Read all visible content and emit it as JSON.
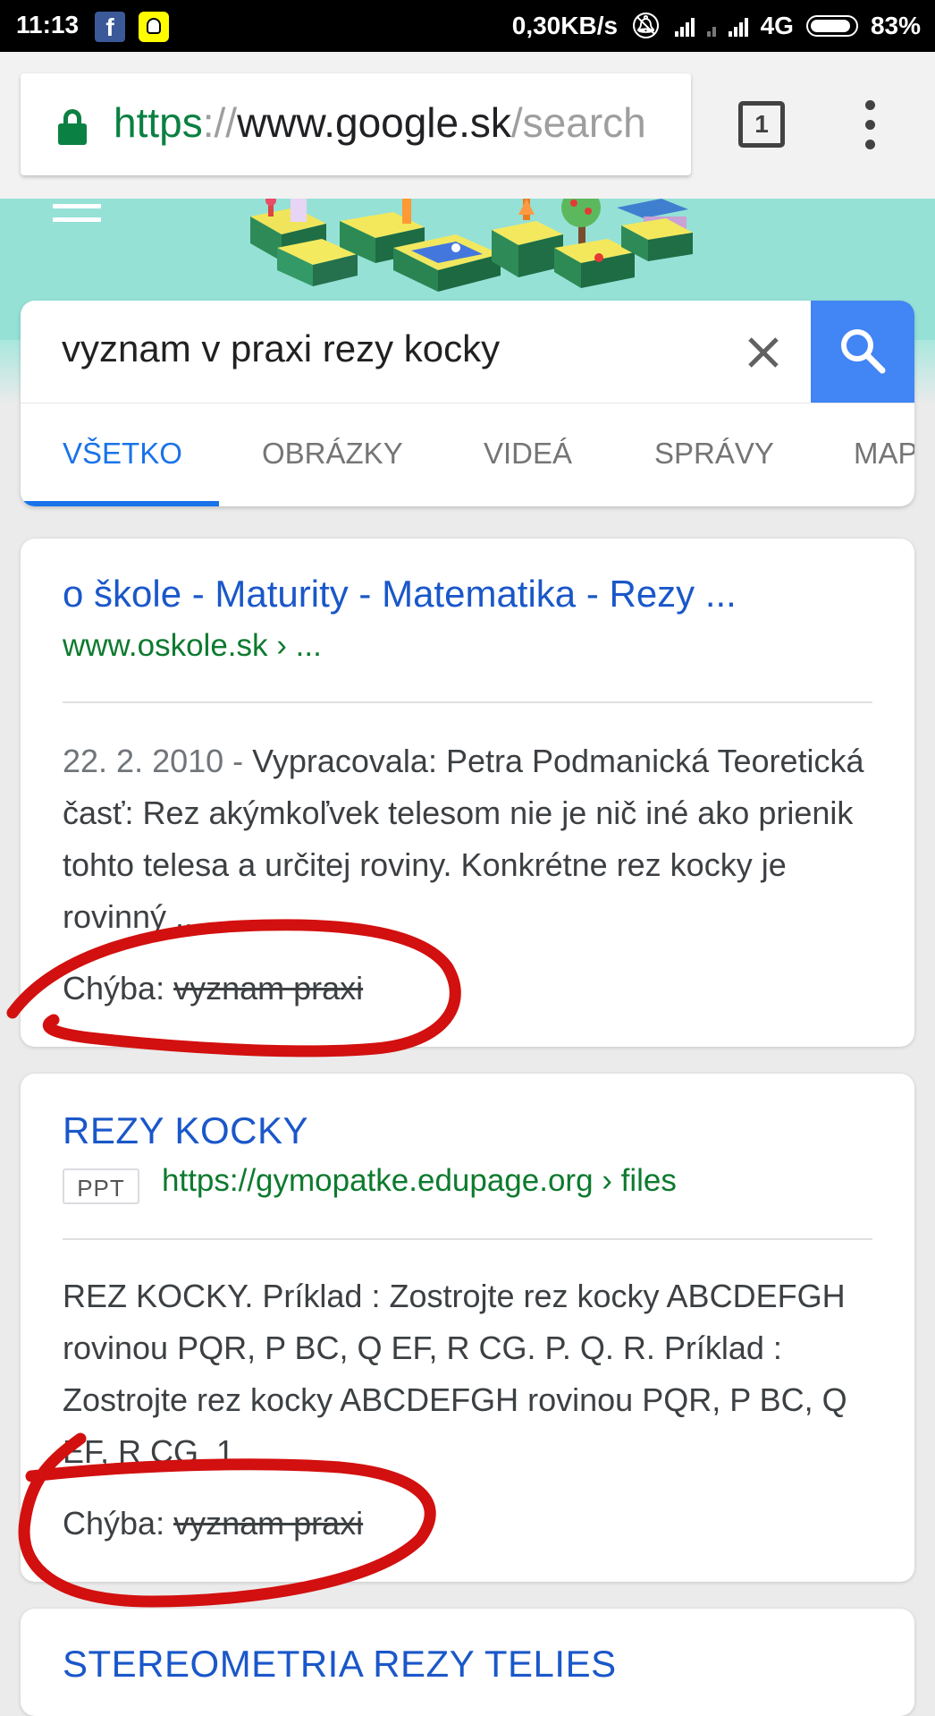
{
  "status_bar": {
    "time": "11:13",
    "speed": "0,30KB/s",
    "network": "4G",
    "battery": "83%",
    "icons": [
      "facebook-icon",
      "snapchat-icon",
      "mute-icon",
      "signal-icon",
      "data-arrows-icon",
      "battery-icon"
    ]
  },
  "browser": {
    "url_scheme": "https",
    "url_separator": "://",
    "url_host": "www.google.sk",
    "url_path": "/search",
    "tab_count": "1"
  },
  "search": {
    "query": "vyznam v praxi rezy kocky",
    "tabs": [
      "VŠETKO",
      "OBRÁZKY",
      "VIDEÁ",
      "SPRÁVY",
      "MAP"
    ],
    "active_tab": "VŠETKO"
  },
  "results": [
    {
      "title": "o škole - Maturity - Matematika - Rezy ...",
      "url": "www.oskole.sk › ...",
      "date": "22. 2. 2010",
      "date_separator": " - ",
      "snippet": "Vypracovala: Petra Podmanická Teoretická časť: Rez akýmkoľvek telesom nie je nič iné ako prienik tohto telesa a určitej roviny. Konkrétne rez kocky je rovinný ...",
      "missing_label": "Chýba:",
      "missing_terms": "vyznam praxi"
    },
    {
      "title": "REZY KOCKY",
      "badge": "PPT",
      "url": "https://gymopatke.edupage.org › files",
      "snippet": "REZ KOCKY. Príklad : Zostrojte rez kocky ABCDEFGH rovinou PQR, P BC, Q EF, R CG. P. Q. R. Príklad : Zostrojte rez kocky ABCDEFGH rovinou PQR, P BC, Q EF, R CG. 1.",
      "missing_label": "Chýba:",
      "missing_terms": "vyznam praxi"
    },
    {
      "title": "STEREOMETRIA REZY TELIES"
    }
  ],
  "colors": {
    "link_blue": "#1a57c9",
    "url_green": "#0d7a2e",
    "doodle_teal": "#95e1d6",
    "search_blue": "#4285f4",
    "annotation_red": "#d2100f"
  }
}
